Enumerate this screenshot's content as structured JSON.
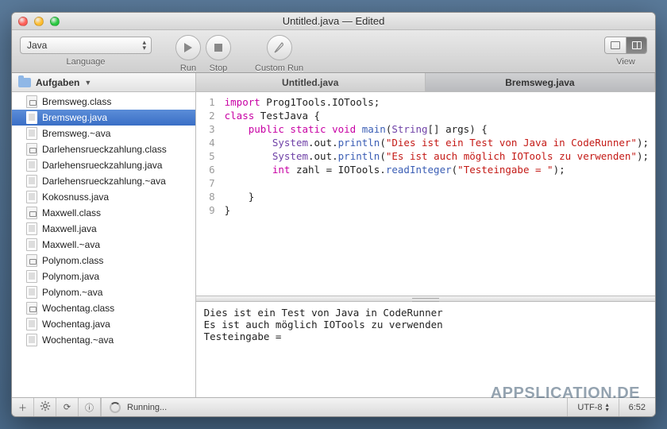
{
  "titlebar": {
    "title": "Untitled.java — Edited"
  },
  "toolbar": {
    "language": {
      "value": "Java",
      "label": "Language"
    },
    "run": "Run",
    "stop": "Stop",
    "custom_run": "Custom Run",
    "view": "View"
  },
  "sidebar": {
    "folder": "Aufgaben",
    "files": [
      {
        "name": "Bremsweg.class",
        "kind": "class",
        "selected": false
      },
      {
        "name": "Bremsweg.java",
        "kind": "java",
        "selected": true
      },
      {
        "name": "Bremsweg.~ava",
        "kind": "java",
        "selected": false
      },
      {
        "name": "Darlehensrueckzahlung.class",
        "kind": "class",
        "selected": false
      },
      {
        "name": "Darlehensrueckzahlung.java",
        "kind": "java",
        "selected": false
      },
      {
        "name": "Darlehensrueckzahlung.~ava",
        "kind": "java",
        "selected": false
      },
      {
        "name": "Kokosnuss.java",
        "kind": "java",
        "selected": false
      },
      {
        "name": "Maxwell.class",
        "kind": "class",
        "selected": false
      },
      {
        "name": "Maxwell.java",
        "kind": "java",
        "selected": false
      },
      {
        "name": "Maxwell.~ava",
        "kind": "java",
        "selected": false
      },
      {
        "name": "Polynom.class",
        "kind": "class",
        "selected": false
      },
      {
        "name": "Polynom.java",
        "kind": "java",
        "selected": false
      },
      {
        "name": "Polynom.~ava",
        "kind": "java",
        "selected": false
      },
      {
        "name": "Wochentag.class",
        "kind": "class",
        "selected": false
      },
      {
        "name": "Wochentag.java",
        "kind": "java",
        "selected": false
      },
      {
        "name": "Wochentag.~ava",
        "kind": "java",
        "selected": false
      }
    ]
  },
  "tabs": [
    {
      "label": "Untitled.java",
      "active": false
    },
    {
      "label": "Bremsweg.java",
      "active": true
    }
  ],
  "code_lines": [
    [
      {
        "t": "kw",
        "s": "import"
      },
      {
        "t": "id",
        "s": " Prog1Tools.IOTools;"
      }
    ],
    [
      {
        "t": "kw",
        "s": "class"
      },
      {
        "t": "id",
        "s": " TestJava {"
      }
    ],
    [
      {
        "t": "id",
        "s": "    "
      },
      {
        "t": "kw",
        "s": "public static void"
      },
      {
        "t": "id",
        "s": " "
      },
      {
        "t": "fn",
        "s": "main"
      },
      {
        "t": "id",
        "s": "("
      },
      {
        "t": "type",
        "s": "String"
      },
      {
        "t": "id",
        "s": "[] args) {"
      }
    ],
    [
      {
        "t": "id",
        "s": "        "
      },
      {
        "t": "type",
        "s": "System"
      },
      {
        "t": "id",
        "s": ".out."
      },
      {
        "t": "fn",
        "s": "println"
      },
      {
        "t": "id",
        "s": "("
      },
      {
        "t": "str",
        "s": "\"Dies ist ein Test von Java in CodeRunner\""
      },
      {
        "t": "id",
        "s": ");"
      }
    ],
    [
      {
        "t": "id",
        "s": "        "
      },
      {
        "t": "type",
        "s": "System"
      },
      {
        "t": "id",
        "s": ".out."
      },
      {
        "t": "fn",
        "s": "println"
      },
      {
        "t": "id",
        "s": "("
      },
      {
        "t": "str",
        "s": "\"Es ist auch möglich IOTools zu verwenden\""
      },
      {
        "t": "id",
        "s": ");"
      }
    ],
    [
      {
        "t": "id",
        "s": "        "
      },
      {
        "t": "kw",
        "s": "int"
      },
      {
        "t": "id",
        "s": " zahl = IOTools."
      },
      {
        "t": "fn",
        "s": "readInteger"
      },
      {
        "t": "id",
        "s": "("
      },
      {
        "t": "str",
        "s": "\"Testeingabe = \""
      },
      {
        "t": "id",
        "s": ");"
      }
    ],
    [
      {
        "t": "id",
        "s": ""
      }
    ],
    [
      {
        "t": "id",
        "s": "    }"
      }
    ],
    [
      {
        "t": "id",
        "s": "}"
      }
    ]
  ],
  "console_output": "Dies ist ein Test von Java in CodeRunner\nEs ist auch möglich IOTools zu verwenden\nTesteingabe = ",
  "statusbar": {
    "status": "Running...",
    "encoding": "UTF-8",
    "position": "6:52"
  },
  "watermark": "APPSLICATION.DE"
}
